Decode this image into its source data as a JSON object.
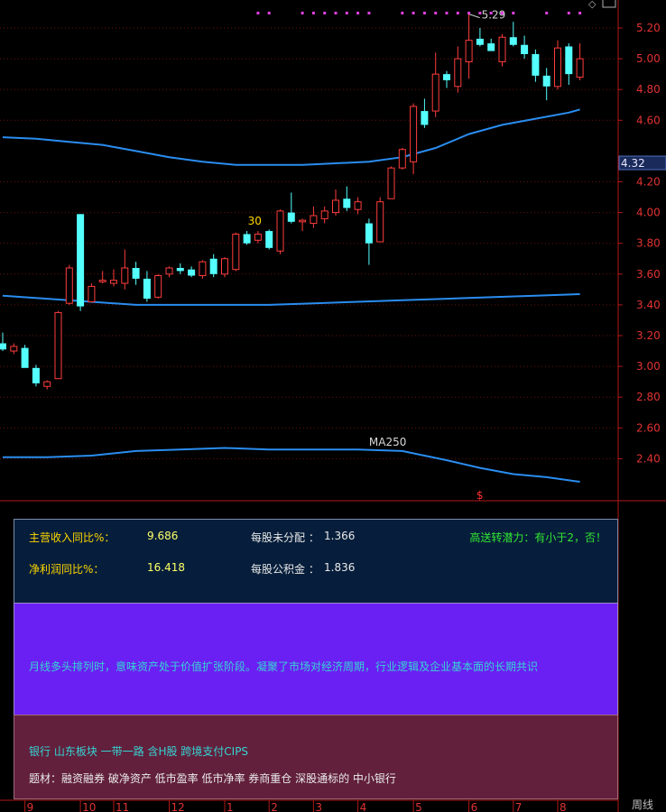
{
  "chart_data": {
    "type": "candlestick",
    "ylim": [
      2.2,
      5.35
    ],
    "y_ticks": [
      2.4,
      2.6,
      2.8,
      3.0,
      3.2,
      3.4,
      3.6,
      3.8,
      4.0,
      4.2,
      4.6,
      4.8,
      5.0,
      5.2
    ],
    "y_tick_labels": [
      "2.40",
      "2.60",
      "2.80",
      "3.00",
      "3.20",
      "3.40",
      "3.60",
      "3.80",
      "4.00",
      "4.20",
      "4.60",
      "4.80",
      "5.00",
      "5.20"
    ],
    "crosshair_price": "4.32",
    "candles": [
      {
        "o": 3.15,
        "h": 3.22,
        "l": 3.1,
        "c": 3.11
      },
      {
        "o": 3.1,
        "h": 3.15,
        "l": 3.08,
        "c": 3.13
      },
      {
        "o": 3.12,
        "h": 3.14,
        "l": 3.0,
        "c": 2.99
      },
      {
        "o": 2.99,
        "h": 3.01,
        "l": 2.87,
        "c": 2.89
      },
      {
        "o": 2.87,
        "h": 2.91,
        "l": 2.85,
        "c": 2.9
      },
      {
        "o": 2.92,
        "h": 3.36,
        "l": 2.92,
        "c": 3.35
      },
      {
        "o": 3.41,
        "h": 3.66,
        "l": 3.4,
        "c": 3.64
      },
      {
        "o": 3.99,
        "h": 3.99,
        "l": 3.36,
        "c": 3.39
      },
      {
        "o": 3.42,
        "h": 3.54,
        "l": 3.42,
        "c": 3.52
      },
      {
        "o": 3.55,
        "h": 3.62,
        "l": 3.54,
        "c": 3.56
      },
      {
        "o": 3.54,
        "h": 3.63,
        "l": 3.52,
        "c": 3.56
      },
      {
        "o": 3.54,
        "h": 3.76,
        "l": 3.5,
        "c": 3.64
      },
      {
        "o": 3.64,
        "h": 3.68,
        "l": 3.53,
        "c": 3.57
      },
      {
        "o": 3.57,
        "h": 3.62,
        "l": 3.42,
        "c": 3.44
      },
      {
        "o": 3.45,
        "h": 3.6,
        "l": 3.44,
        "c": 3.59
      },
      {
        "o": 3.6,
        "h": 3.65,
        "l": 3.58,
        "c": 3.64
      },
      {
        "o": 3.64,
        "h": 3.67,
        "l": 3.6,
        "c": 3.62
      },
      {
        "o": 3.63,
        "h": 3.65,
        "l": 3.58,
        "c": 3.59
      },
      {
        "o": 3.59,
        "h": 3.69,
        "l": 3.57,
        "c": 3.68
      },
      {
        "o": 3.7,
        "h": 3.73,
        "l": 3.58,
        "c": 3.6
      },
      {
        "o": 3.6,
        "h": 3.71,
        "l": 3.58,
        "c": 3.7
      },
      {
        "o": 3.63,
        "h": 3.87,
        "l": 3.62,
        "c": 3.86
      },
      {
        "o": 3.86,
        "h": 3.88,
        "l": 3.79,
        "c": 3.8
      },
      {
        "o": 3.82,
        "h": 3.88,
        "l": 3.8,
        "c": 3.86
      },
      {
        "o": 3.88,
        "h": 3.89,
        "l": 3.76,
        "c": 3.77
      },
      {
        "o": 3.75,
        "h": 4.02,
        "l": 3.73,
        "c": 4.01
      },
      {
        "o": 4.0,
        "h": 4.13,
        "l": 3.93,
        "c": 3.94
      },
      {
        "o": 3.94,
        "h": 3.96,
        "l": 3.88,
        "c": 3.95
      },
      {
        "o": 3.93,
        "h": 4.04,
        "l": 3.9,
        "c": 3.98
      },
      {
        "o": 3.96,
        "h": 4.04,
        "l": 3.93,
        "c": 4.01
      },
      {
        "o": 4.0,
        "h": 4.15,
        "l": 3.98,
        "c": 4.08
      },
      {
        "o": 4.09,
        "h": 4.17,
        "l": 4.01,
        "c": 4.03
      },
      {
        "o": 4.02,
        "h": 4.1,
        "l": 3.99,
        "c": 4.07
      },
      {
        "o": 3.93,
        "h": 3.96,
        "l": 3.66,
        "c": 3.8
      },
      {
        "o": 3.81,
        "h": 4.1,
        "l": 3.81,
        "c": 4.07
      },
      {
        "o": 4.09,
        "h": 4.3,
        "l": 4.09,
        "c": 4.29
      },
      {
        "o": 4.29,
        "h": 4.42,
        "l": 4.28,
        "c": 4.41
      },
      {
        "o": 4.33,
        "h": 4.71,
        "l": 4.25,
        "c": 4.69
      },
      {
        "o": 4.66,
        "h": 4.74,
        "l": 4.55,
        "c": 4.57
      },
      {
        "o": 4.66,
        "h": 5.04,
        "l": 4.62,
        "c": 4.9
      },
      {
        "o": 4.9,
        "h": 4.92,
        "l": 4.81,
        "c": 4.86
      },
      {
        "o": 4.82,
        "h": 5.08,
        "l": 4.78,
        "c": 5.0
      },
      {
        "o": 4.98,
        "h": 5.29,
        "l": 4.87,
        "c": 5.12
      },
      {
        "o": 5.13,
        "h": 5.2,
        "l": 5.08,
        "c": 5.09
      },
      {
        "o": 5.1,
        "h": 5.13,
        "l": 5.06,
        "c": 5.05
      },
      {
        "o": 4.98,
        "h": 5.16,
        "l": 4.95,
        "c": 5.14
      },
      {
        "o": 5.14,
        "h": 5.24,
        "l": 5.08,
        "c": 5.09
      },
      {
        "o": 5.09,
        "h": 5.15,
        "l": 5.0,
        "c": 5.03
      },
      {
        "o": 5.03,
        "h": 5.06,
        "l": 4.85,
        "c": 4.89
      },
      {
        "o": 4.89,
        "h": 4.94,
        "l": 4.73,
        "c": 4.82
      },
      {
        "o": 4.82,
        "h": 5.12,
        "l": 4.8,
        "c": 5.07
      },
      {
        "o": 5.08,
        "h": 5.1,
        "l": 4.83,
        "c": 4.9
      },
      {
        "o": 4.88,
        "h": 5.1,
        "l": 4.86,
        "c": 5.0
      }
    ],
    "upper_line": [
      [
        0,
        4.49
      ],
      [
        3,
        4.48
      ],
      [
        6,
        4.46
      ],
      [
        9,
        4.44
      ],
      [
        12,
        4.4
      ],
      [
        15,
        4.36
      ],
      [
        18,
        4.33
      ],
      [
        21,
        4.31
      ],
      [
        24,
        4.31
      ],
      [
        27,
        4.31
      ],
      [
        30,
        4.32
      ],
      [
        33,
        4.33
      ],
      [
        36,
        4.36
      ],
      [
        39,
        4.42
      ],
      [
        42,
        4.51
      ],
      [
        45,
        4.57
      ],
      [
        48,
        4.61
      ],
      [
        51,
        4.65
      ],
      [
        52,
        4.67
      ]
    ],
    "middle_line": [
      [
        0,
        3.46
      ],
      [
        4,
        3.44
      ],
      [
        8,
        3.42
      ],
      [
        12,
        3.4
      ],
      [
        16,
        3.4
      ],
      [
        20,
        3.4
      ],
      [
        24,
        3.4
      ],
      [
        28,
        3.41
      ],
      [
        32,
        3.42
      ],
      [
        36,
        3.43
      ],
      [
        40,
        3.44
      ],
      [
        44,
        3.45
      ],
      [
        48,
        3.46
      ],
      [
        52,
        3.47
      ]
    ],
    "lower_line": [
      [
        0,
        2.41
      ],
      [
        4,
        2.41
      ],
      [
        8,
        2.42
      ],
      [
        12,
        2.45
      ],
      [
        16,
        2.46
      ],
      [
        20,
        2.47
      ],
      [
        24,
        2.46
      ],
      [
        28,
        2.46
      ],
      [
        32,
        2.46
      ],
      [
        36,
        2.45
      ],
      [
        38,
        2.42
      ],
      [
        40,
        2.39
      ],
      [
        43,
        2.34
      ],
      [
        46,
        2.3
      ],
      [
        49,
        2.28
      ],
      [
        52,
        2.25
      ]
    ],
    "annotations": {
      "high_label": "5.29",
      "high_index": 42,
      "mid_label": "30",
      "mid_index": 22,
      "mid_price": 3.92,
      "ma_label": "MA250",
      "ma_label_index": 33,
      "signal_mark": "$",
      "signal_index": 43
    },
    "markers_top_indices": [
      23,
      24,
      27,
      28,
      29,
      30,
      31,
      32,
      33,
      36,
      37,
      38,
      39,
      40,
      41,
      42,
      43,
      44,
      45,
      46,
      49,
      51,
      52
    ],
    "x_labels": [
      {
        "i": 2,
        "label": "9"
      },
      {
        "i": 7,
        "label": "10"
      },
      {
        "i": 10,
        "label": "11"
      },
      {
        "i": 15,
        "label": "12"
      },
      {
        "i": 20,
        "label": "1"
      },
      {
        "i": 24,
        "label": "2"
      },
      {
        "i": 28,
        "label": "3"
      },
      {
        "i": 32,
        "label": "4"
      },
      {
        "i": 37,
        "label": "5"
      },
      {
        "i": 42,
        "label": "6"
      },
      {
        "i": 46,
        "label": "7"
      },
      {
        "i": 50,
        "label": "8"
      }
    ],
    "colors": {
      "up": "#ff3c3c",
      "down": "#54ffff",
      "line": "#2a8df0",
      "grid": "#6a0f0f",
      "axis": "#b01818",
      "tick": "#e03232"
    }
  },
  "fin": {
    "revenue_label": "主营收入同比%：",
    "revenue_value": "9.686",
    "profit_label": "净利润同比%：",
    "profit_value": "16.418",
    "undistributed_label": "每股未分配 ：",
    "undistributed_value": "1.366",
    "reserve_label": "每股公积金 ：",
    "reserve_value": "1.836",
    "note": "高送转潜力：有小于2，否！"
  },
  "concept": {
    "text": "月线多头排列时，意味资产处于价值扩张阶段。凝聚了市场对经济周期，行业逻辑及企业基本面的长期共识"
  },
  "tags": {
    "line1": "银行 山东板块 一带一路 含H股 跨境支付CIPS",
    "line2": "题材：融资融券 破净资产 低市盈率 低市净率 券商重仓 深股通标的 中小银行"
  },
  "period_button": "周线"
}
